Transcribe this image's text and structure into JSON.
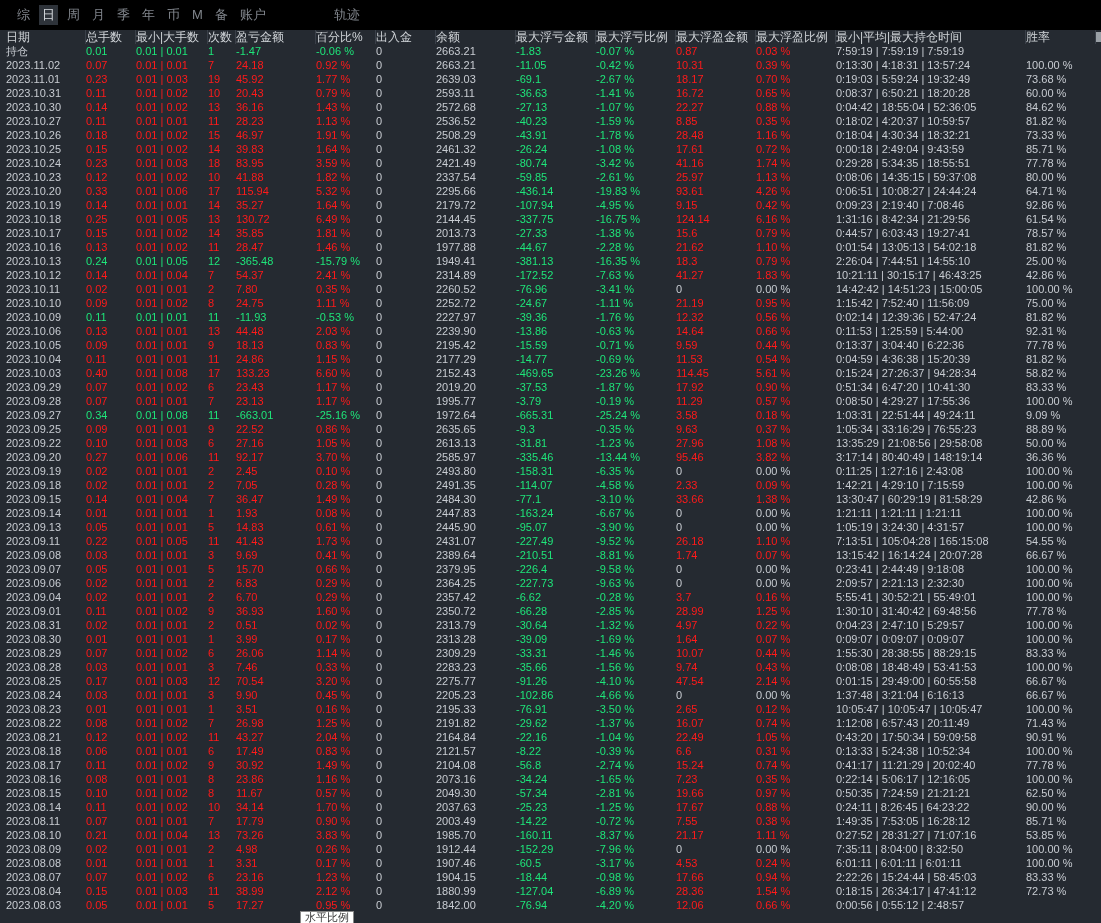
{
  "tabs": [
    {
      "label": "综",
      "selected": false
    },
    {
      "label": "日",
      "selected": true
    },
    {
      "label": "周",
      "selected": false
    },
    {
      "label": "月",
      "selected": false
    },
    {
      "label": "季",
      "selected": false
    },
    {
      "label": "年",
      "selected": false
    },
    {
      "label": "币",
      "selected": false
    },
    {
      "label": "M",
      "selected": false
    },
    {
      "label": "备",
      "selected": false
    },
    {
      "label": "账户",
      "selected": false
    }
  ],
  "extra_tabs": [
    {
      "label": "轨迹",
      "selected": false
    }
  ],
  "table": {
    "columns": [
      {
        "label": "日期",
        "kind": "date"
      },
      {
        "label": "总手数",
        "kind": "trade"
      },
      {
        "label": "最小|大手数",
        "kind": "trade"
      },
      {
        "label": "次数",
        "kind": "trade"
      },
      {
        "label": "盈亏金额",
        "kind": "trade"
      },
      {
        "label": "百分比%",
        "kind": "trade"
      },
      {
        "label": "出入金",
        "kind": "plain"
      },
      {
        "label": "余额",
        "kind": "plain"
      },
      {
        "label": "最大浮亏金额",
        "kind": "loss"
      },
      {
        "label": "最大浮亏比例",
        "kind": "loss"
      },
      {
        "label": "最大浮盈金额",
        "kind": "profit"
      },
      {
        "label": "最大浮盈比例",
        "kind": "profit"
      },
      {
        "label": "最小|平均|最大持仓时间",
        "kind": "plain"
      },
      {
        "label": "胜率",
        "kind": "plain"
      }
    ],
    "rows": [
      {
        "cells": [
          "持仓",
          "0.01",
          "0.01 | 0.01",
          "1",
          "-1.47",
          "-0.06 %",
          "0",
          "2663.21",
          "-1.83",
          "-0.07 %",
          "0.87",
          "0.03 %",
          "7:59:19 | 7:59:19 | 7:59:19"
        ],
        "profitable": false,
        "float_gain": true
      },
      {
        "cells": [
          "2023.11.02",
          "0.07",
          "0.01 | 0.01",
          "7",
          "24.18",
          "0.92 %",
          "0",
          "2663.21",
          "-11.05",
          "-0.42 %",
          "10.31",
          "0.39 %",
          "0:13:30 | 4:18:31 | 13:57:24",
          "100.00 %"
        ],
        "profitable": true,
        "float_gain": true
      },
      {
        "cells": [
          "2023.11.01",
          "0.23",
          "0.01 | 0.03",
          "19",
          "45.92",
          "1.77 %",
          "0",
          "2639.03",
          "-69.1",
          "-2.67 %",
          "18.17",
          "0.70 %",
          "0:19:03 | 5:59:24 | 19:32:49",
          "73.68 %"
        ],
        "profitable": true,
        "float_gain": true
      },
      {
        "cells": [
          "2023.10.31",
          "0.11",
          "0.01 | 0.02",
          "10",
          "20.43",
          "0.79 %",
          "0",
          "2593.11",
          "-36.63",
          "-1.41 %",
          "16.72",
          "0.65 %",
          "0:08:37 | 6:50:21 | 18:20:28",
          "60.00 %"
        ],
        "profitable": true,
        "float_gain": true
      },
      {
        "cells": [
          "2023.10.30",
          "0.14",
          "0.01 | 0.02",
          "13",
          "36.16",
          "1.43 %",
          "0",
          "2572.68",
          "-27.13",
          "-1.07 %",
          "22.27",
          "0.88 %",
          "0:04:42 | 18:55:04 | 52:36:05",
          "84.62 %"
        ],
        "profitable": true,
        "float_gain": true
      },
      {
        "cells": [
          "2023.10.27",
          "0.11",
          "0.01 | 0.01",
          "11",
          "28.23",
          "1.13 %",
          "0",
          "2536.52",
          "-40.23",
          "-1.59 %",
          "8.85",
          "0.35 %",
          "0:18:02 | 4:20:37 | 10:59:57",
          "81.82 %"
        ],
        "profitable": true,
        "float_gain": true
      },
      {
        "cells": [
          "2023.10.26",
          "0.18",
          "0.01 | 0.02",
          "15",
          "46.97",
          "1.91 %",
          "0",
          "2508.29",
          "-43.91",
          "-1.78 %",
          "28.48",
          "1.16 %",
          "0:18:04 | 4:30:34 | 18:32:21",
          "73.33 %"
        ],
        "profitable": true,
        "float_gain": true
      },
      {
        "cells": [
          "2023.10.25",
          "0.15",
          "0.01 | 0.02",
          "14",
          "39.83",
          "1.64 %",
          "0",
          "2461.32",
          "-26.24",
          "-1.08 %",
          "17.61",
          "0.72 %",
          "0:00:18 | 2:49:04 | 9:43:59",
          "85.71 %"
        ],
        "profitable": true,
        "float_gain": true
      },
      {
        "cells": [
          "2023.10.24",
          "0.23",
          "0.01 | 0.03",
          "18",
          "83.95",
          "3.59 %",
          "0",
          "2421.49",
          "-80.74",
          "-3.42 %",
          "41.16",
          "1.74 %",
          "0:29:28 | 5:34:35 | 18:55:51",
          "77.78 %"
        ],
        "profitable": true,
        "float_gain": true
      },
      {
        "cells": [
          "2023.10.23",
          "0.12",
          "0.01 | 0.02",
          "10",
          "41.88",
          "1.82 %",
          "0",
          "2337.54",
          "-59.85",
          "-2.61 %",
          "25.97",
          "1.13 %",
          "0:08:06 | 14:35:15 | 59:37:08",
          "80.00 %"
        ],
        "profitable": true,
        "float_gain": true
      },
      {
        "cells": [
          "2023.10.20",
          "0.33",
          "0.01 | 0.06",
          "17",
          "115.94",
          "5.32 %",
          "0",
          "2295.66",
          "-436.14",
          "-19.83 %",
          "93.61",
          "4.26 %",
          "0:06:51 | 10:08:27 | 24:44:24",
          "64.71 %"
        ],
        "profitable": true,
        "float_gain": true
      },
      {
        "cells": [
          "2023.10.19",
          "0.14",
          "0.01 | 0.01",
          "14",
          "35.27",
          "1.64 %",
          "0",
          "2179.72",
          "-107.94",
          "-4.95 %",
          "9.15",
          "0.42 %",
          "0:09:23 | 2:19:40 | 7:08:46",
          "92.86 %"
        ],
        "profitable": true,
        "float_gain": true
      },
      {
        "cells": [
          "2023.10.18",
          "0.25",
          "0.01 | 0.05",
          "13",
          "130.72",
          "6.49 %",
          "0",
          "2144.45",
          "-337.75",
          "-16.75 %",
          "124.14",
          "6.16 %",
          "1:31:16 | 8:42:34 | 21:29:56",
          "61.54 %"
        ],
        "profitable": true,
        "float_gain": true
      },
      {
        "cells": [
          "2023.10.17",
          "0.15",
          "0.01 | 0.02",
          "14",
          "35.85",
          "1.81 %",
          "0",
          "2013.73",
          "-27.33",
          "-1.38 %",
          "15.6",
          "0.79 %",
          "0:44:57 | 6:03:43 | 19:27:41",
          "78.57 %"
        ],
        "profitable": true,
        "float_gain": true
      },
      {
        "cells": [
          "2023.10.16",
          "0.13",
          "0.01 | 0.02",
          "11",
          "28.47",
          "1.46 %",
          "0",
          "1977.88",
          "-44.67",
          "-2.28 %",
          "21.62",
          "1.10 %",
          "0:01:54 | 13:05:13 | 54:02:18",
          "81.82 %"
        ],
        "profitable": true,
        "float_gain": true
      },
      {
        "cells": [
          "2023.10.13",
          "0.24",
          "0.01 | 0.05",
          "12",
          "-365.48",
          "-15.79 %",
          "0",
          "1949.41",
          "-381.13",
          "-16.35 %",
          "18.3",
          "0.79 %",
          "2:26:04 | 7:44:51 | 14:55:10",
          "25.00 %"
        ],
        "profitable": false,
        "float_gain": true
      },
      {
        "cells": [
          "2023.10.12",
          "0.14",
          "0.01 | 0.04",
          "7",
          "54.37",
          "2.41 %",
          "0",
          "2314.89",
          "-172.52",
          "-7.63 %",
          "41.27",
          "1.83 %",
          "10:21:11 | 30:15:17 | 46:43:25",
          "42.86 %"
        ],
        "profitable": true,
        "float_gain": true
      },
      {
        "cells": [
          "2023.10.11",
          "0.02",
          "0.01 | 0.01",
          "2",
          "7.80",
          "0.35 %",
          "0",
          "2260.52",
          "-76.96",
          "-3.41 %",
          "0",
          "0.00 %",
          "14:42:42 | 14:51:23 | 15:00:05",
          "100.00 %"
        ],
        "profitable": true,
        "float_gain": false
      },
      {
        "cells": [
          "2023.10.10",
          "0.09",
          "0.01 | 0.02",
          "8",
          "24.75",
          "1.11 %",
          "0",
          "2252.72",
          "-24.67",
          "-1.11 %",
          "21.19",
          "0.95 %",
          "1:15:42 | 7:52:40 | 11:56:09",
          "75.00 %"
        ],
        "profitable": true,
        "float_gain": true
      },
      {
        "cells": [
          "2023.10.09",
          "0.11",
          "0.01 | 0.01",
          "11",
          "-11.93",
          "-0.53 %",
          "0",
          "2227.97",
          "-39.36",
          "-1.76 %",
          "12.32",
          "0.56 %",
          "0:02:14 | 12:39:36 | 52:47:24",
          "81.82 %"
        ],
        "profitable": false,
        "float_gain": true
      },
      {
        "cells": [
          "2023.10.06",
          "0.13",
          "0.01 | 0.01",
          "13",
          "44.48",
          "2.03 %",
          "0",
          "2239.90",
          "-13.86",
          "-0.63 %",
          "14.64",
          "0.66 %",
          "0:11:53 | 1:25:59 | 5:44:00",
          "92.31 %"
        ],
        "profitable": true,
        "float_gain": true
      },
      {
        "cells": [
          "2023.10.05",
          "0.09",
          "0.01 | 0.01",
          "9",
          "18.13",
          "0.83 %",
          "0",
          "2195.42",
          "-15.59",
          "-0.71 %",
          "9.59",
          "0.44 %",
          "0:13:37 | 3:04:40 | 6:22:36",
          "77.78 %"
        ],
        "profitable": true,
        "float_gain": true
      },
      {
        "cells": [
          "2023.10.04",
          "0.11",
          "0.01 | 0.01",
          "11",
          "24.86",
          "1.15 %",
          "0",
          "2177.29",
          "-14.77",
          "-0.69 %",
          "11.53",
          "0.54 %",
          "0:04:59 | 4:36:38 | 15:20:39",
          "81.82 %"
        ],
        "profitable": true,
        "float_gain": true
      },
      {
        "cells": [
          "2023.10.03",
          "0.40",
          "0.01 | 0.08",
          "17",
          "133.23",
          "6.60 %",
          "0",
          "2152.43",
          "-469.65",
          "-23.26 %",
          "114.45",
          "5.61 %",
          "0:15:24 | 27:26:37 | 94:28:34",
          "58.82 %"
        ],
        "profitable": true,
        "float_gain": true
      },
      {
        "cells": [
          "2023.09.29",
          "0.07",
          "0.01 | 0.02",
          "6",
          "23.43",
          "1.17 %",
          "0",
          "2019.20",
          "-37.53",
          "-1.87 %",
          "17.92",
          "0.90 %",
          "0:51:34 | 6:47:20 | 10:41:30",
          "83.33 %"
        ],
        "profitable": true,
        "float_gain": true
      },
      {
        "cells": [
          "2023.09.28",
          "0.07",
          "0.01 | 0.01",
          "7",
          "23.13",
          "1.17 %",
          "0",
          "1995.77",
          "-3.79",
          "-0.19 %",
          "11.29",
          "0.57 %",
          "0:08:50 | 4:29:27 | 17:55:36",
          "100.00 %"
        ],
        "profitable": true,
        "float_gain": true
      },
      {
        "cells": [
          "2023.09.27",
          "0.34",
          "0.01 | 0.08",
          "11",
          "-663.01",
          "-25.16 %",
          "0",
          "1972.64",
          "-665.31",
          "-25.24 %",
          "3.58",
          "0.18 %",
          "1:03:31 | 22:51:44 | 49:24:11",
          "9.09 %"
        ],
        "profitable": false,
        "float_gain": true
      },
      {
        "cells": [
          "2023.09.25",
          "0.09",
          "0.01 | 0.01",
          "9",
          "22.52",
          "0.86 %",
          "0",
          "2635.65",
          "-9.3",
          "-0.35 %",
          "9.63",
          "0.37 %",
          "1:05:34 | 33:16:29 | 76:55:23",
          "88.89 %"
        ],
        "profitable": true,
        "float_gain": true
      },
      {
        "cells": [
          "2023.09.22",
          "0.10",
          "0.01 | 0.03",
          "6",
          "27.16",
          "1.05 %",
          "0",
          "2613.13",
          "-31.81",
          "-1.23 %",
          "27.96",
          "1.08 %",
          "13:35:29 | 21:08:56 | 29:58:08",
          "50.00 %"
        ],
        "profitable": true,
        "float_gain": true
      },
      {
        "cells": [
          "2023.09.20",
          "0.27",
          "0.01 | 0.06",
          "11",
          "92.17",
          "3.70 %",
          "0",
          "2585.97",
          "-335.46",
          "-13.44 %",
          "95.46",
          "3.82 %",
          "3:17:14 | 80:40:49 | 148:19:14",
          "36.36 %"
        ],
        "profitable": true,
        "float_gain": true
      },
      {
        "cells": [
          "2023.09.19",
          "0.02",
          "0.01 | 0.01",
          "2",
          "2.45",
          "0.10 %",
          "0",
          "2493.80",
          "-158.31",
          "-6.35 %",
          "0",
          "0.00 %",
          "0:11:25 | 1:27:16 | 2:43:08",
          "100.00 %"
        ],
        "profitable": true,
        "float_gain": false
      },
      {
        "cells": [
          "2023.09.18",
          "0.02",
          "0.01 | 0.01",
          "2",
          "7.05",
          "0.28 %",
          "0",
          "2491.35",
          "-114.07",
          "-4.58 %",
          "2.33",
          "0.09 %",
          "1:42:21 | 4:29:10 | 7:15:59",
          "100.00 %"
        ],
        "profitable": true,
        "float_gain": true
      },
      {
        "cells": [
          "2023.09.15",
          "0.14",
          "0.01 | 0.04",
          "7",
          "36.47",
          "1.49 %",
          "0",
          "2484.30",
          "-77.1",
          "-3.10 %",
          "33.66",
          "1.38 %",
          "13:30:47 | 60:29:19 | 81:58:29",
          "42.86 %"
        ],
        "profitable": true,
        "float_gain": true
      },
      {
        "cells": [
          "2023.09.14",
          "0.01",
          "0.01 | 0.01",
          "1",
          "1.93",
          "0.08 %",
          "0",
          "2447.83",
          "-163.24",
          "-6.67 %",
          "0",
          "0.00 %",
          "1:21:11 | 1:21:11 | 1:21:11",
          "100.00 %"
        ],
        "profitable": true,
        "float_gain": false
      },
      {
        "cells": [
          "2023.09.13",
          "0.05",
          "0.01 | 0.01",
          "5",
          "14.83",
          "0.61 %",
          "0",
          "2445.90",
          "-95.07",
          "-3.90 %",
          "0",
          "0.00 %",
          "1:05:19 | 3:24:30 | 4:31:57",
          "100.00 %"
        ],
        "profitable": true,
        "float_gain": false
      },
      {
        "cells": [
          "2023.09.11",
          "0.22",
          "0.01 | 0.05",
          "11",
          "41.43",
          "1.73 %",
          "0",
          "2431.07",
          "-227.49",
          "-9.52 %",
          "26.18",
          "1.10 %",
          "7:13:51 | 105:04:28 | 165:15:08",
          "54.55 %"
        ],
        "profitable": true,
        "float_gain": true
      },
      {
        "cells": [
          "2023.09.08",
          "0.03",
          "0.01 | 0.01",
          "3",
          "9.69",
          "0.41 %",
          "0",
          "2389.64",
          "-210.51",
          "-8.81 %",
          "1.74",
          "0.07 %",
          "13:15:42 | 16:14:24 | 20:07:28",
          "66.67 %"
        ],
        "profitable": true,
        "float_gain": true
      },
      {
        "cells": [
          "2023.09.07",
          "0.05",
          "0.01 | 0.01",
          "5",
          "15.70",
          "0.66 %",
          "0",
          "2379.95",
          "-226.4",
          "-9.58 %",
          "0",
          "0.00 %",
          "0:23:41 | 2:44:49 | 9:18:08",
          "100.00 %"
        ],
        "profitable": true,
        "float_gain": false
      },
      {
        "cells": [
          "2023.09.06",
          "0.02",
          "0.01 | 0.01",
          "2",
          "6.83",
          "0.29 %",
          "0",
          "2364.25",
          "-227.73",
          "-9.63 %",
          "0",
          "0.00 %",
          "2:09:57 | 2:21:13 | 2:32:30",
          "100.00 %"
        ],
        "profitable": true,
        "float_gain": false
      },
      {
        "cells": [
          "2023.09.04",
          "0.02",
          "0.01 | 0.01",
          "2",
          "6.70",
          "0.29 %",
          "0",
          "2357.42",
          "-6.62",
          "-0.28 %",
          "3.7",
          "0.16 %",
          "5:55:41 | 30:52:21 | 55:49:01",
          "100.00 %"
        ],
        "profitable": true,
        "float_gain": true
      },
      {
        "cells": [
          "2023.09.01",
          "0.11",
          "0.01 | 0.02",
          "9",
          "36.93",
          "1.60 %",
          "0",
          "2350.72",
          "-66.28",
          "-2.85 %",
          "28.99",
          "1.25 %",
          "1:30:10 | 31:40:42 | 69:48:56",
          "77.78 %"
        ],
        "profitable": true,
        "float_gain": true
      },
      {
        "cells": [
          "2023.08.31",
          "0.02",
          "0.01 | 0.01",
          "2",
          "0.51",
          "0.02 %",
          "0",
          "2313.79",
          "-30.64",
          "-1.32 %",
          "4.97",
          "0.22 %",
          "0:04:23 | 2:47:10 | 5:29:57",
          "100.00 %"
        ],
        "profitable": true,
        "float_gain": true
      },
      {
        "cells": [
          "2023.08.30",
          "0.01",
          "0.01 | 0.01",
          "1",
          "3.99",
          "0.17 %",
          "0",
          "2313.28",
          "-39.09",
          "-1.69 %",
          "1.64",
          "0.07 %",
          "0:09:07 | 0:09:07 | 0:09:07",
          "100.00 %"
        ],
        "profitable": true,
        "float_gain": true
      },
      {
        "cells": [
          "2023.08.29",
          "0.07",
          "0.01 | 0.02",
          "6",
          "26.06",
          "1.14 %",
          "0",
          "2309.29",
          "-33.31",
          "-1.46 %",
          "10.07",
          "0.44 %",
          "1:55:30 | 28:38:55 | 88:29:15",
          "83.33 %"
        ],
        "profitable": true,
        "float_gain": true
      },
      {
        "cells": [
          "2023.08.28",
          "0.03",
          "0.01 | 0.01",
          "3",
          "7.46",
          "0.33 %",
          "0",
          "2283.23",
          "-35.66",
          "-1.56 %",
          "9.74",
          "0.43 %",
          "0:08:08 | 18:48:49 | 53:41:53",
          "100.00 %"
        ],
        "profitable": true,
        "float_gain": true
      },
      {
        "cells": [
          "2023.08.25",
          "0.17",
          "0.01 | 0.03",
          "12",
          "70.54",
          "3.20 %",
          "0",
          "2275.77",
          "-91.26",
          "-4.10 %",
          "47.54",
          "2.14 %",
          "0:01:15 | 29:49:00 | 60:55:58",
          "66.67 %"
        ],
        "profitable": true,
        "float_gain": true
      },
      {
        "cells": [
          "2023.08.24",
          "0.03",
          "0.01 | 0.01",
          "3",
          "9.90",
          "0.45 %",
          "0",
          "2205.23",
          "-102.86",
          "-4.66 %",
          "0",
          "0.00 %",
          "1:37:48 | 3:21:04 | 6:16:13",
          "66.67 %"
        ],
        "profitable": true,
        "float_gain": false
      },
      {
        "cells": [
          "2023.08.23",
          "0.01",
          "0.01 | 0.01",
          "1",
          "3.51",
          "0.16 %",
          "0",
          "2195.33",
          "-76.91",
          "-3.50 %",
          "2.65",
          "0.12 %",
          "10:05:47 | 10:05:47 | 10:05:47",
          "100.00 %"
        ],
        "profitable": true,
        "float_gain": true
      },
      {
        "cells": [
          "2023.08.22",
          "0.08",
          "0.01 | 0.02",
          "7",
          "26.98",
          "1.25 %",
          "0",
          "2191.82",
          "-29.62",
          "-1.37 %",
          "16.07",
          "0.74 %",
          "1:12:08 | 6:57:43 | 20:11:49",
          "71.43 %"
        ],
        "profitable": true,
        "float_gain": true
      },
      {
        "cells": [
          "2023.08.21",
          "0.12",
          "0.01 | 0.02",
          "11",
          "43.27",
          "2.04 %",
          "0",
          "2164.84",
          "-22.16",
          "-1.04 %",
          "22.49",
          "1.05 %",
          "0:43:20 | 17:50:34 | 59:09:58",
          "90.91 %"
        ],
        "profitable": true,
        "float_gain": true
      },
      {
        "cells": [
          "2023.08.18",
          "0.06",
          "0.01 | 0.01",
          "6",
          "17.49",
          "0.83 %",
          "0",
          "2121.57",
          "-8.22",
          "-0.39 %",
          "6.6",
          "0.31 %",
          "0:13:33 | 5:24:38 | 10:52:34",
          "100.00 %"
        ],
        "profitable": true,
        "float_gain": true
      },
      {
        "cells": [
          "2023.08.17",
          "0.11",
          "0.01 | 0.02",
          "9",
          "30.92",
          "1.49 %",
          "0",
          "2104.08",
          "-56.8",
          "-2.74 %",
          "15.24",
          "0.74 %",
          "0:41:17 | 11:21:29 | 20:02:40",
          "77.78 %"
        ],
        "profitable": true,
        "float_gain": true
      },
      {
        "cells": [
          "2023.08.16",
          "0.08",
          "0.01 | 0.01",
          "8",
          "23.86",
          "1.16 %",
          "0",
          "2073.16",
          "-34.24",
          "-1.65 %",
          "7.23",
          "0.35 %",
          "0:22:14 | 5:06:17 | 12:16:05",
          "100.00 %"
        ],
        "profitable": true,
        "float_gain": true
      },
      {
        "cells": [
          "2023.08.15",
          "0.10",
          "0.01 | 0.02",
          "8",
          "11.67",
          "0.57 %",
          "0",
          "2049.30",
          "-57.34",
          "-2.81 %",
          "19.66",
          "0.97 %",
          "0:50:35 | 7:24:59 | 21:21:21",
          "62.50 %"
        ],
        "profitable": true,
        "float_gain": true
      },
      {
        "cells": [
          "2023.08.14",
          "0.11",
          "0.01 | 0.02",
          "10",
          "34.14",
          "1.70 %",
          "0",
          "2037.63",
          "-25.23",
          "-1.25 %",
          "17.67",
          "0.88 %",
          "0:24:11 | 8:26:45 | 64:23:22",
          "90.00 %"
        ],
        "profitable": true,
        "float_gain": true
      },
      {
        "cells": [
          "2023.08.11",
          "0.07",
          "0.01 | 0.01",
          "7",
          "17.79",
          "0.90 %",
          "0",
          "2003.49",
          "-14.22",
          "-0.72 %",
          "7.55",
          "0.38 %",
          "1:49:35 | 7:53:05 | 16:28:12",
          "85.71 %"
        ],
        "profitable": true,
        "float_gain": true
      },
      {
        "cells": [
          "2023.08.10",
          "0.21",
          "0.01 | 0.04",
          "13",
          "73.26",
          "3.83 %",
          "0",
          "1985.70",
          "-160.11",
          "-8.37 %",
          "21.17",
          "1.11 %",
          "0:27:52 | 28:31:27 | 71:07:16",
          "53.85 %"
        ],
        "profitable": true,
        "float_gain": true
      },
      {
        "cells": [
          "2023.08.09",
          "0.02",
          "0.01 | 0.01",
          "2",
          "4.98",
          "0.26 %",
          "0",
          "1912.44",
          "-152.29",
          "-7.96 %",
          "0",
          "0.00 %",
          "7:35:11 | 8:04:00 | 8:32:50",
          "100.00 %"
        ],
        "profitable": true,
        "float_gain": false
      },
      {
        "cells": [
          "2023.08.08",
          "0.01",
          "0.01 | 0.01",
          "1",
          "3.31",
          "0.17 %",
          "0",
          "1907.46",
          "-60.5",
          "-3.17 %",
          "4.53",
          "0.24 %",
          "6:01:11 | 6:01:11 | 6:01:11",
          "100.00 %"
        ],
        "profitable": true,
        "float_gain": true
      },
      {
        "cells": [
          "2023.08.07",
          "0.07",
          "0.01 | 0.02",
          "6",
          "23.16",
          "1.23 %",
          "0",
          "1904.15",
          "-18.44",
          "-0.98 %",
          "17.66",
          "0.94 %",
          "2:22:26 | 15:24:44 | 58:45:03",
          "83.33 %"
        ],
        "profitable": true,
        "float_gain": true
      },
      {
        "cells": [
          "2023.08.04",
          "0.15",
          "0.01 | 0.03",
          "11",
          "38.99",
          "2.12 %",
          "0",
          "1880.99",
          "-127.04",
          "-6.89 %",
          "28.36",
          "1.54 %",
          "0:18:15 | 26:34:17 | 47:41:12",
          "72.73 %"
        ],
        "profitable": true,
        "float_gain": true
      },
      {
        "cells": [
          "2023.08.03",
          "0.05",
          "0.01 | 0.01",
          "5",
          "17.27",
          "0.95 %",
          "0",
          "1842.00",
          "-76.94",
          "-4.20 %",
          "12.06",
          "0.66 %",
          "0:00:56 | 0:55:12 | 2:48:57"
        ],
        "profitable": true,
        "float_gain": true
      }
    ]
  },
  "tooltip": {
    "text": "水平比例"
  }
}
